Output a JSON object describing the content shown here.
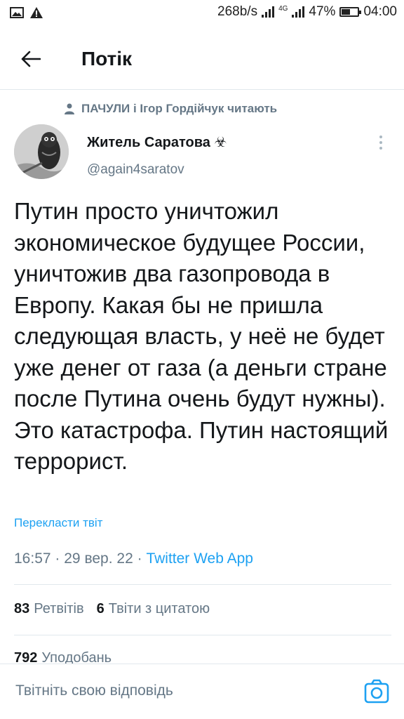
{
  "status_bar": {
    "net_speed": "268b/s",
    "network_type": "4G",
    "battery": "47%",
    "battery_level": 0.47,
    "time": "04:00"
  },
  "header": {
    "title": "Потік",
    "back_icon": "arrow-left-icon"
  },
  "context": {
    "text": "ПАЧУЛИ і Ігор Гордійчук читають",
    "icon": "person-icon"
  },
  "tweet": {
    "author_name": "Житель Саратова ☣",
    "handle": "@again4saratov",
    "text": "Путин просто уничтожил экономическое будущее России, уничтожив два газопровода в Европу. Какая бы не пришла следующая власть, у неё не будет уже денег от газа (а деньги стране после Путина очень будут нужны). Это катастрофа. Путин настоящий террорист.",
    "translate_label": "Перекласти твіт",
    "time": "16:57",
    "date": "29 вер. 22",
    "source": "Twitter Web App",
    "separator": "·"
  },
  "stats": {
    "retweets_count": "83",
    "retweets_label": "Ретвітів",
    "quotes_count": "6",
    "quotes_label": "Твіти з цитатою",
    "likes_count": "792",
    "likes_label": "Уподобань"
  },
  "reply": {
    "placeholder": "Твітніть свою відповідь",
    "camera_icon": "camera-icon"
  }
}
